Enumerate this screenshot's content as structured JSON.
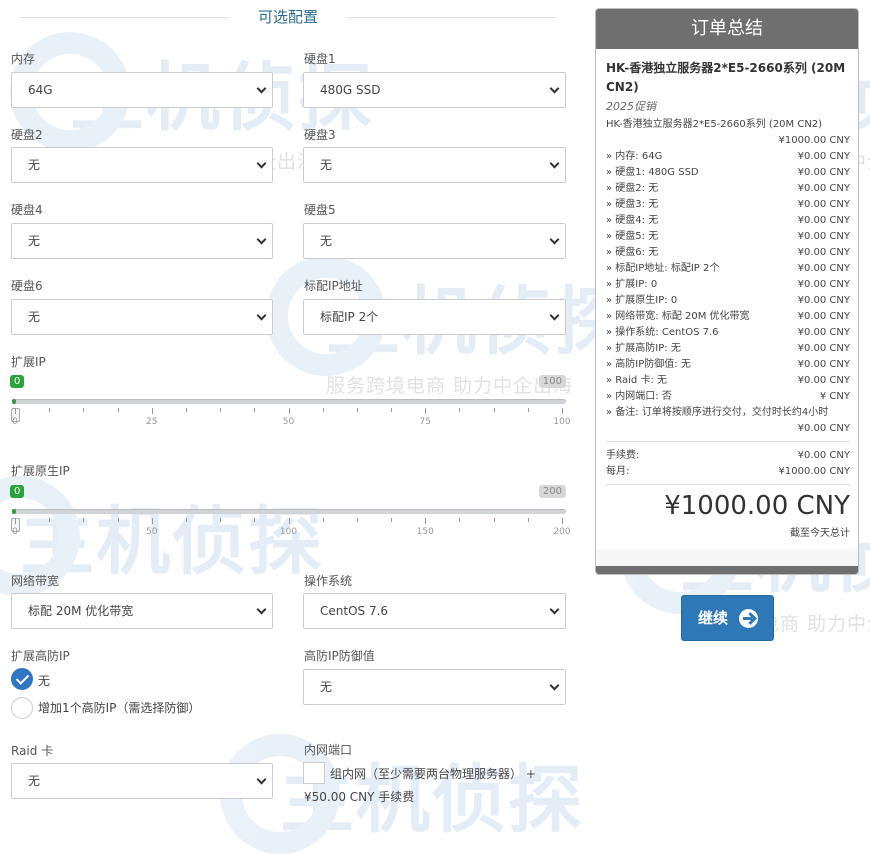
{
  "section_title": "可选配置",
  "fields": {
    "memory": {
      "label": "内存",
      "value": "64G"
    },
    "disk1": {
      "label": "硬盘1",
      "value": "480G SSD"
    },
    "disk2": {
      "label": "硬盘2",
      "value": "无"
    },
    "disk3": {
      "label": "硬盘3",
      "value": "无"
    },
    "disk4": {
      "label": "硬盘4",
      "value": "无"
    },
    "disk5": {
      "label": "硬盘5",
      "value": "无"
    },
    "disk6": {
      "label": "硬盘6",
      "value": "无"
    },
    "std_ip": {
      "label": "标配IP地址",
      "value": "标配IP 2个"
    },
    "bandwidth": {
      "label": "网络带宽",
      "value": "标配 20M 优化带宽"
    },
    "os": {
      "label": "操作系统",
      "value": "CentOS 7.6"
    },
    "ddos_value": {
      "label": "高防IP防御值",
      "value": "无"
    },
    "raid": {
      "label": "Raid 卡",
      "value": "无"
    }
  },
  "sliders": {
    "ext_ip": {
      "label": "扩展IP",
      "value": 0,
      "min": 0,
      "max": 100,
      "min_badge": "0",
      "max_badge": "100",
      "ticks": [
        "0",
        "25",
        "50",
        "75",
        "100"
      ]
    },
    "ext_native_ip": {
      "label": "扩展原生IP",
      "value": 0,
      "min": 0,
      "max": 200,
      "min_badge": "0",
      "max_badge": "200",
      "ticks": [
        "0",
        "50",
        "100",
        "150",
        "200"
      ]
    }
  },
  "ddos_ip": {
    "label": "扩展高防IP",
    "options": [
      {
        "label": "无",
        "checked": true
      },
      {
        "label": "增加1个高防IP（需选择防御）",
        "checked": false
      }
    ]
  },
  "intranet": {
    "label": "内网端口",
    "checkbox_label": "组内网（至少需要两台物理服务器） +",
    "fee": "¥50.00 CNY 手续费"
  },
  "summary": {
    "title": "订单总结",
    "product_name": "HK-香港独立服务器2*E5-2660系列 (20M CN2)",
    "product_group": "2025促销",
    "base_line": "HK-香港独立服务器2*E5-2660系列 (20M CN2)",
    "base_price": "¥1000.00 CNY",
    "items": [
      {
        "label": "» 内存: 64G",
        "price": "¥0.00 CNY"
      },
      {
        "label": "» 硬盘1: 480G SSD",
        "price": "¥0.00 CNY"
      },
      {
        "label": "» 硬盘2: 无",
        "price": "¥0.00 CNY"
      },
      {
        "label": "» 硬盘3: 无",
        "price": "¥0.00 CNY"
      },
      {
        "label": "» 硬盘4: 无",
        "price": "¥0.00 CNY"
      },
      {
        "label": "» 硬盘5: 无",
        "price": "¥0.00 CNY"
      },
      {
        "label": "» 硬盘6: 无",
        "price": "¥0.00 CNY"
      },
      {
        "label": "» 标配IP地址: 标配IP 2个",
        "price": "¥0.00 CNY"
      },
      {
        "label": "» 扩展IP: 0",
        "price": "¥0.00 CNY"
      },
      {
        "label": "» 扩展原生IP: 0",
        "price": "¥0.00 CNY"
      },
      {
        "label": "» 网络带宽: 标配 20M 优化带宽",
        "price": "¥0.00 CNY"
      },
      {
        "label": "» 操作系统: CentOS 7.6",
        "price": "¥0.00 CNY"
      },
      {
        "label": "» 扩展高防IP: 无",
        "price": "¥0.00 CNY"
      },
      {
        "label": "» 高防IP防御值: 无",
        "price": "¥0.00 CNY"
      },
      {
        "label": "» Raid 卡: 无",
        "price": "¥0.00 CNY"
      },
      {
        "label": "» 内网端口: 否",
        "price": "¥ CNY"
      }
    ],
    "note": "» 备注: 订单将按顺序进行交付，交付时长约4小时",
    "note_price": "¥0.00 CNY",
    "fee_label": "手续费:",
    "fee_value": "¥0.00 CNY",
    "monthly_label": "每月:",
    "monthly_value": "¥1000.00 CNY",
    "total": "¥1000.00 CNY",
    "total_caption": "截至今天总计"
  },
  "continue_button": "继续",
  "watermark": {
    "logo": "主机侦探",
    "slogan": "服务跨境电商 助力中企出海"
  }
}
